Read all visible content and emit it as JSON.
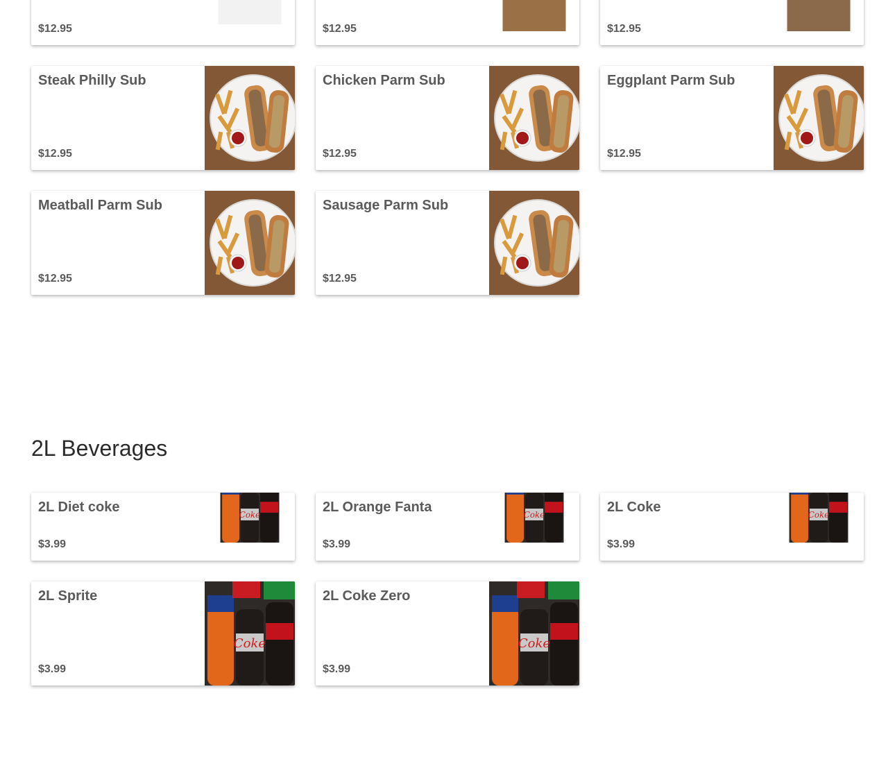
{
  "top_row": [
    {
      "price": "$12.95",
      "image": "sub-with-sauce-photo"
    },
    {
      "price": "$12.95",
      "image": "sub-with-fries-photo"
    },
    {
      "price": "$12.95",
      "image": "sub-with-salad-photo"
    }
  ],
  "subs": [
    {
      "name": "Steak Philly Sub",
      "price": "$12.95",
      "image": "steak-philly-photo"
    },
    {
      "name": "Chicken Parm Sub",
      "price": "$12.95",
      "image": "parm-sub-photo"
    },
    {
      "name": "Eggplant Parm Sub",
      "price": "$12.95",
      "image": "parm-sub-photo"
    },
    {
      "name": "Meatball Parm Sub",
      "price": "$12.95",
      "image": "parm-sub-photo"
    },
    {
      "name": "Sausage Parm Sub",
      "price": "$12.95",
      "image": "parm-sub-photo"
    }
  ],
  "beverages": {
    "title": "2L Beverages",
    "items": [
      {
        "name": "2L Diet coke",
        "price": "$3.99",
        "image": "soda-bottles-photo"
      },
      {
        "name": "2L Orange Fanta",
        "price": "$3.99",
        "image": "soda-bottles-photo"
      },
      {
        "name": "2L Coke",
        "price": "$3.99",
        "image": "soda-bottles-photo"
      },
      {
        "name": "2L Sprite",
        "price": "$3.99",
        "image": "soda-bottles-photo"
      },
      {
        "name": "2L Coke Zero",
        "price": "$3.99",
        "image": "soda-bottles-photo"
      }
    ]
  }
}
